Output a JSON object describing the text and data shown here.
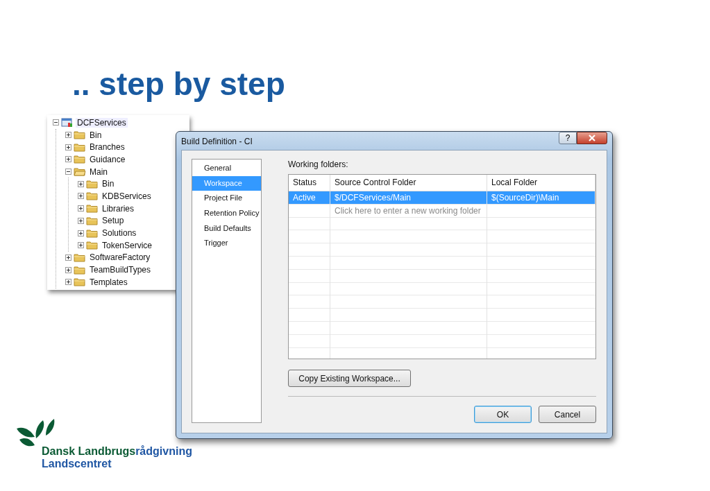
{
  "slide_title": ".. step by step",
  "tree": {
    "items": [
      {
        "label": "DCFServices",
        "kind": "project",
        "expanded": true,
        "children": [
          {
            "label": "Bin",
            "kind": "folder",
            "expanded": false
          },
          {
            "label": "Branches",
            "kind": "folder",
            "expanded": false
          },
          {
            "label": "Guidance",
            "kind": "folder",
            "expanded": false
          },
          {
            "label": "Main",
            "kind": "folder",
            "expanded": true,
            "children": [
              {
                "label": "Bin",
                "kind": "folder",
                "expanded": false
              },
              {
                "label": "KDBServices",
                "kind": "folder",
                "expanded": false
              },
              {
                "label": "Libraries",
                "kind": "folder",
                "expanded": false
              },
              {
                "label": "Setup",
                "kind": "folder",
                "expanded": false
              },
              {
                "label": "Solutions",
                "kind": "folder",
                "expanded": false
              },
              {
                "label": "TokenService",
                "kind": "folder",
                "expanded": false
              }
            ]
          },
          {
            "label": "SoftwareFactory",
            "kind": "folder",
            "expanded": false
          },
          {
            "label": "TeamBuildTypes",
            "kind": "folder",
            "expanded": false
          },
          {
            "label": "Templates",
            "kind": "folder",
            "expanded": false
          }
        ]
      }
    ]
  },
  "dialog": {
    "title": "Build Definition - CI",
    "help_button": "?",
    "nav": [
      {
        "label": "General",
        "selected": false
      },
      {
        "label": "Workspace",
        "selected": true
      },
      {
        "label": "Project File",
        "selected": false
      },
      {
        "label": "Retention Policy",
        "selected": false
      },
      {
        "label": "Build Defaults",
        "selected": false
      },
      {
        "label": "Trigger",
        "selected": false
      }
    ],
    "section_label": "Working folders:",
    "table": {
      "columns": [
        "Status",
        "Source Control Folder",
        "Local Folder"
      ],
      "rows": [
        {
          "cells": [
            "Active",
            "$/DCFServices/Main",
            "$(SourceDir)\\Main"
          ],
          "selected": true
        }
      ],
      "new_row_placeholder": "Click here to enter a new working folder"
    },
    "copy_button": "Copy Existing Workspace...",
    "buttons": [
      {
        "label": "OK",
        "default": true
      },
      {
        "label": "Cancel",
        "default": false
      }
    ]
  },
  "logo": {
    "name_parts": [
      {
        "text": "Dansk Landbrugs",
        "color": "#0b5a34"
      },
      {
        "text": "rådgivning",
        "color": "#1f56a3"
      }
    ],
    "subtitle": "Landscentret"
  }
}
